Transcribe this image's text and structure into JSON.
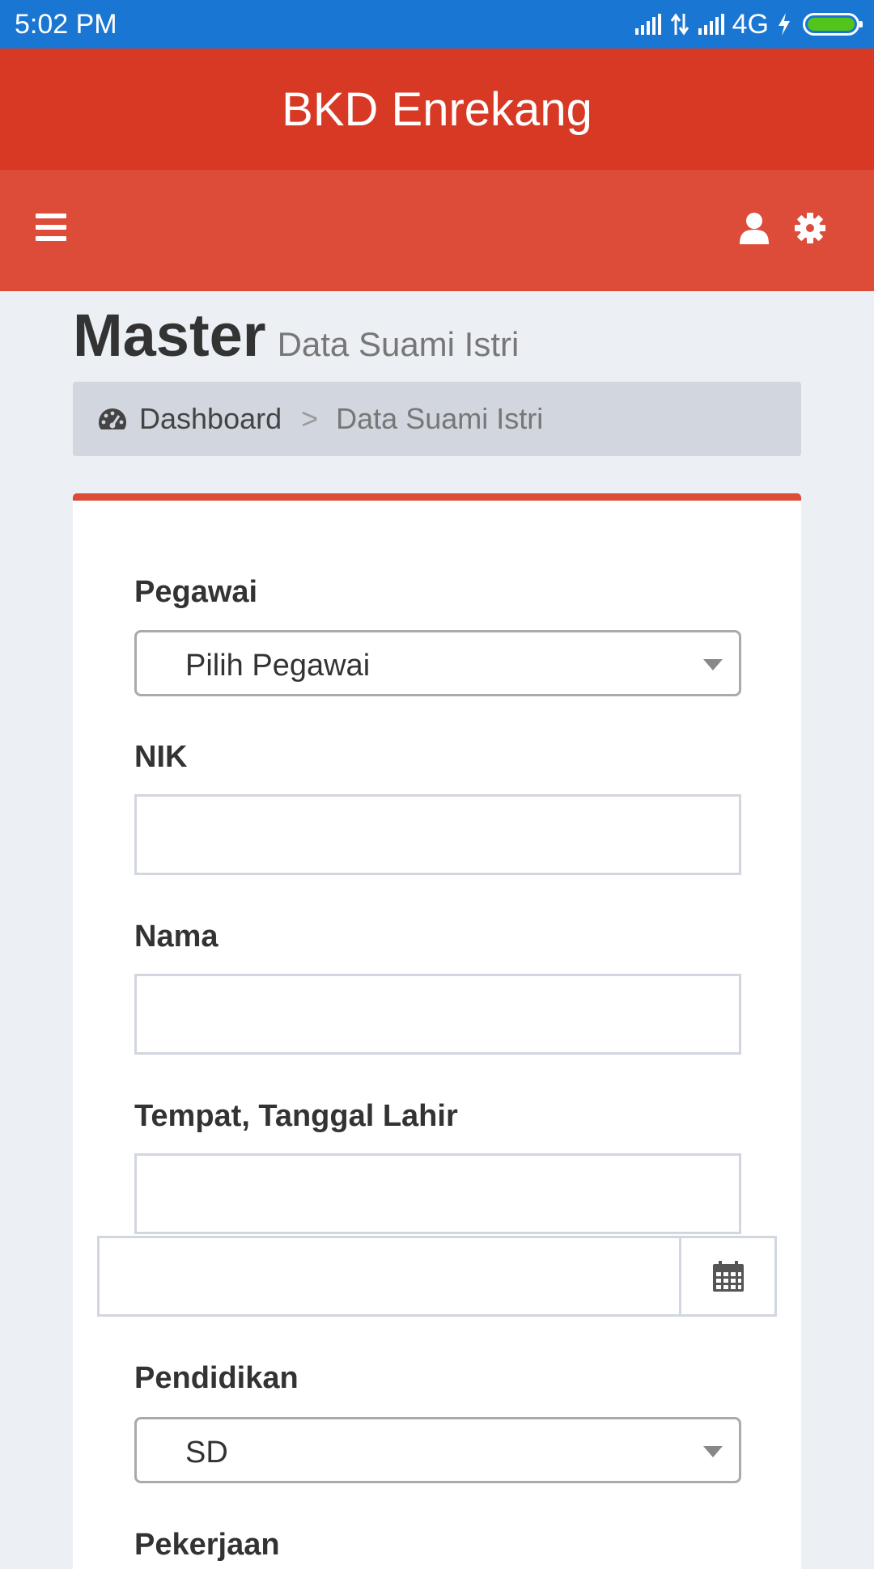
{
  "status_bar": {
    "time": "5:02 PM",
    "network": "4G"
  },
  "app": {
    "title": "BKD Enrekang"
  },
  "page": {
    "title": "Master",
    "subtitle": "Data Suami Istri"
  },
  "breadcrumb": {
    "home": "Dashboard",
    "separator": ">",
    "current": "Data Suami Istri"
  },
  "form": {
    "pegawai": {
      "label": "Pegawai",
      "selected": "Pilih Pegawai"
    },
    "nik": {
      "label": "NIK",
      "value": ""
    },
    "nama": {
      "label": "Nama",
      "value": ""
    },
    "ttl": {
      "label": "Tempat, Tanggal Lahir",
      "place_value": "",
      "date_value": ""
    },
    "pendidikan": {
      "label": "Pendidikan",
      "selected": "SD"
    },
    "pekerjaan": {
      "label": "Pekerjaan"
    }
  },
  "colors": {
    "status_bar": "#1976d2",
    "brand": "#d73925",
    "navbar": "#dd4b39",
    "background": "#ecf0f5"
  },
  "icons": {
    "menu": "hamburger-menu-icon",
    "user": "user-icon",
    "settings": "gear-icon",
    "dashboard": "dashboard-gauge-icon",
    "calendar": "calendar-icon"
  }
}
